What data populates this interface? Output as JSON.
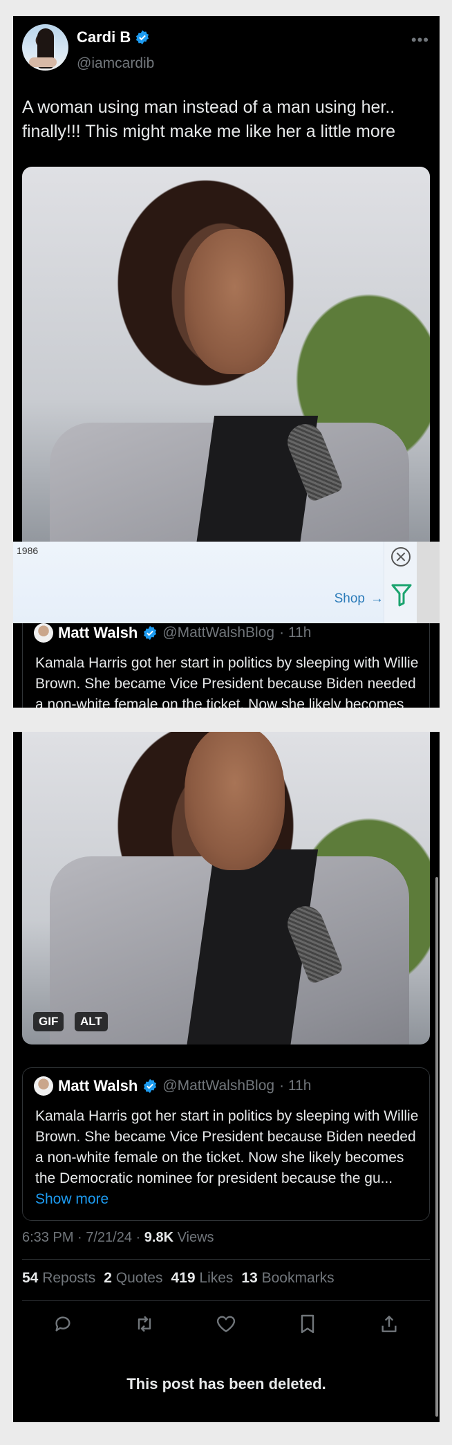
{
  "tweet": {
    "author_name": "Cardi B",
    "author_handle": "@iamcardib",
    "more_icon": "•••",
    "text": "A woman using man instead of a man using her.. finally!!! This might make me like her a little more"
  },
  "quote": {
    "author_name": "Matt Walsh",
    "author_handle": "@MattWalshBlog",
    "time": "· 11h",
    "text_partial": "Kamala Harris got her start in politics by sleeping with Willie Brown. She became Vice President because Biden needed a non-white female on the ticket. Now she likely becomes the Democratic",
    "text_full": "Kamala Harris got her start in politics by sleeping with Willie Brown. She became Vice President because Biden needed a non-white female on the ticket. Now she likely becomes the Democratic nominee for president because the gu...",
    "show_more": "Show more"
  },
  "media": {
    "gif_badge": "GIF",
    "alt_badge": "ALT"
  },
  "meta": {
    "timestamp": "6:33 PM · 7/21/24 · ",
    "views_count": "9.8K",
    "views_label": " Views"
  },
  "stats": [
    {
      "count": "54",
      "label": "Reposts"
    },
    {
      "count": "2",
      "label": "Quotes"
    },
    {
      "count": "419",
      "label": "Likes"
    },
    {
      "count": "13",
      "label": "Bookmarks"
    }
  ],
  "deleted_notice": "This post has been deleted.",
  "ad": {
    "number": "1986",
    "shop_label": "Shop",
    "arrow": "→"
  },
  "colors": {
    "background": "#000000",
    "text": "#e7e9ea",
    "muted": "#71767b",
    "verified_blue": "#1d9bf0"
  }
}
